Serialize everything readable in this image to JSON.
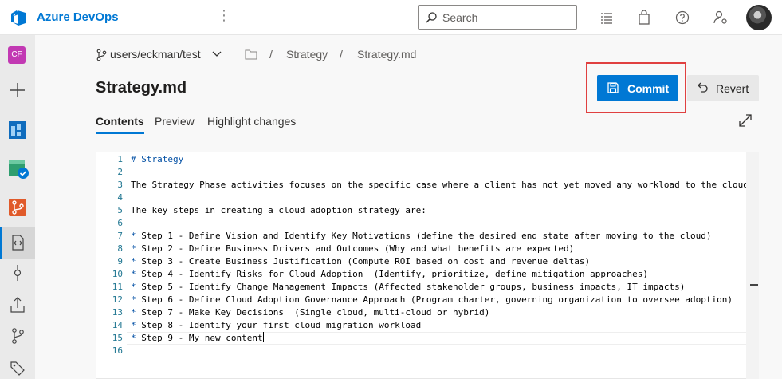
{
  "topbar": {
    "brand": "Azure DevOps",
    "search_placeholder": "Search",
    "icons": [
      "azure-devops-logo",
      "more-vertical-icon",
      "search-icon",
      "work-items-icon",
      "marketplace-bag-icon",
      "help-icon",
      "user-settings-icon",
      "avatar"
    ]
  },
  "leftnav": {
    "project_badge": "CF",
    "items": [
      "add-icon",
      "boards-icon",
      "pipelines-check-icon",
      "repos-icon",
      "files-icon",
      "commits-icon",
      "pushes-icon",
      "branches-icon",
      "tags-icon"
    ]
  },
  "breadcrumb": {
    "branch": "users/eckman/test",
    "separator": "/",
    "items": [
      "Strategy",
      "Strategy.md"
    ]
  },
  "file": {
    "title": "Strategy.md",
    "commit_label": "Commit",
    "revert_label": "Revert"
  },
  "tabs": [
    "Contents",
    "Preview",
    "Highlight changes"
  ],
  "colors": {
    "accent": "#0078d4",
    "highlight_box": "#e04040",
    "line_number": "#237893",
    "markdown_token": "#0451a5"
  },
  "editor": {
    "lines": [
      {
        "n": "1",
        "prefix": "# Strategy",
        "text": ""
      },
      {
        "n": "2",
        "prefix": "",
        "text": ""
      },
      {
        "n": "3",
        "prefix": "",
        "text": "The Strategy Phase activities focuses on the specific case where a client has not yet moved any workload to the cloud an"
      },
      {
        "n": "4",
        "prefix": "",
        "text": ""
      },
      {
        "n": "5",
        "prefix": "",
        "text": "The key steps in creating a cloud adoption strategy are:"
      },
      {
        "n": "6",
        "prefix": "",
        "text": ""
      },
      {
        "n": "7",
        "prefix": "*",
        "text": " Step 1 - Define Vision and Identify Key Motivations (define the desired end state after moving to the cloud)"
      },
      {
        "n": "8",
        "prefix": "*",
        "text": " Step 2 - Define Business Drivers and Outcomes (Why and what benefits are expected)"
      },
      {
        "n": "9",
        "prefix": "*",
        "text": " Step 3 - Create Business Justification (Compute ROI based on cost and revenue deltas)"
      },
      {
        "n": "10",
        "prefix": "*",
        "text": " Step 4 - Identify Risks for Cloud Adoption  (Identify, prioritize, define mitigation approaches)"
      },
      {
        "n": "11",
        "prefix": "*",
        "text": " Step 5 - Identify Change Management Impacts (Affected stakeholder groups, business impacts, IT impacts)"
      },
      {
        "n": "12",
        "prefix": "*",
        "text": " Step 6 - Define Cloud Adoption Governance Approach (Program charter, governing organization to oversee adoption)"
      },
      {
        "n": "13",
        "prefix": "*",
        "text": " Step 7 - Make Key Decisions  (Single cloud, multi-cloud or hybrid)"
      },
      {
        "n": "14",
        "prefix": "*",
        "text": " Step 8 - Identify your first cloud migration workload"
      },
      {
        "n": "15",
        "prefix": "*",
        "text": " Step 9 - My new content"
      },
      {
        "n": "16",
        "prefix": "",
        "text": ""
      }
    ],
    "cursor_line": 15
  }
}
